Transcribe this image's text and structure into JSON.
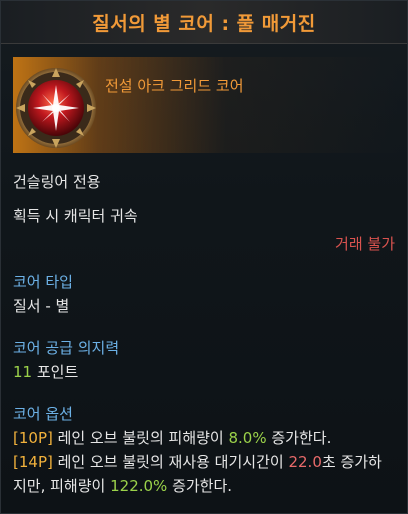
{
  "title": "질서의 별 코어 : 풀 매거진",
  "grade": "전설 아크 그리드 코어",
  "class_only": "건슬링어 전용",
  "bind": "획득 시 캐릭터 귀속",
  "trade": "거래 불가",
  "core_type": {
    "label": "코어 타입",
    "value": "질서 - 별"
  },
  "core_supply": {
    "label": "코어 공급 의지력",
    "value": "11",
    "unit": " 포인트"
  },
  "core_options": {
    "label": "코어 옵션",
    "opt1": {
      "tag": "[10P]",
      "pre": " 레인 오브 불릿의 피해량이 ",
      "value": "8.0%",
      "post": " 증가한다."
    },
    "opt2": {
      "tag": "[14P]",
      "pre": " 레인 오브 불릿의 재사용 대기시간이 ",
      "value": "22.0",
      "mid": "초 증가하지만, 피해량이 ",
      "value2": "122.0%",
      "post": " 증가한다."
    }
  },
  "colors": {
    "title": "#f19a38",
    "section": "#6cb1e6",
    "green": "#9bd24a",
    "red": "#e86a6a",
    "tag": "#f2b23c"
  },
  "icon": "order-star-core-emblem"
}
